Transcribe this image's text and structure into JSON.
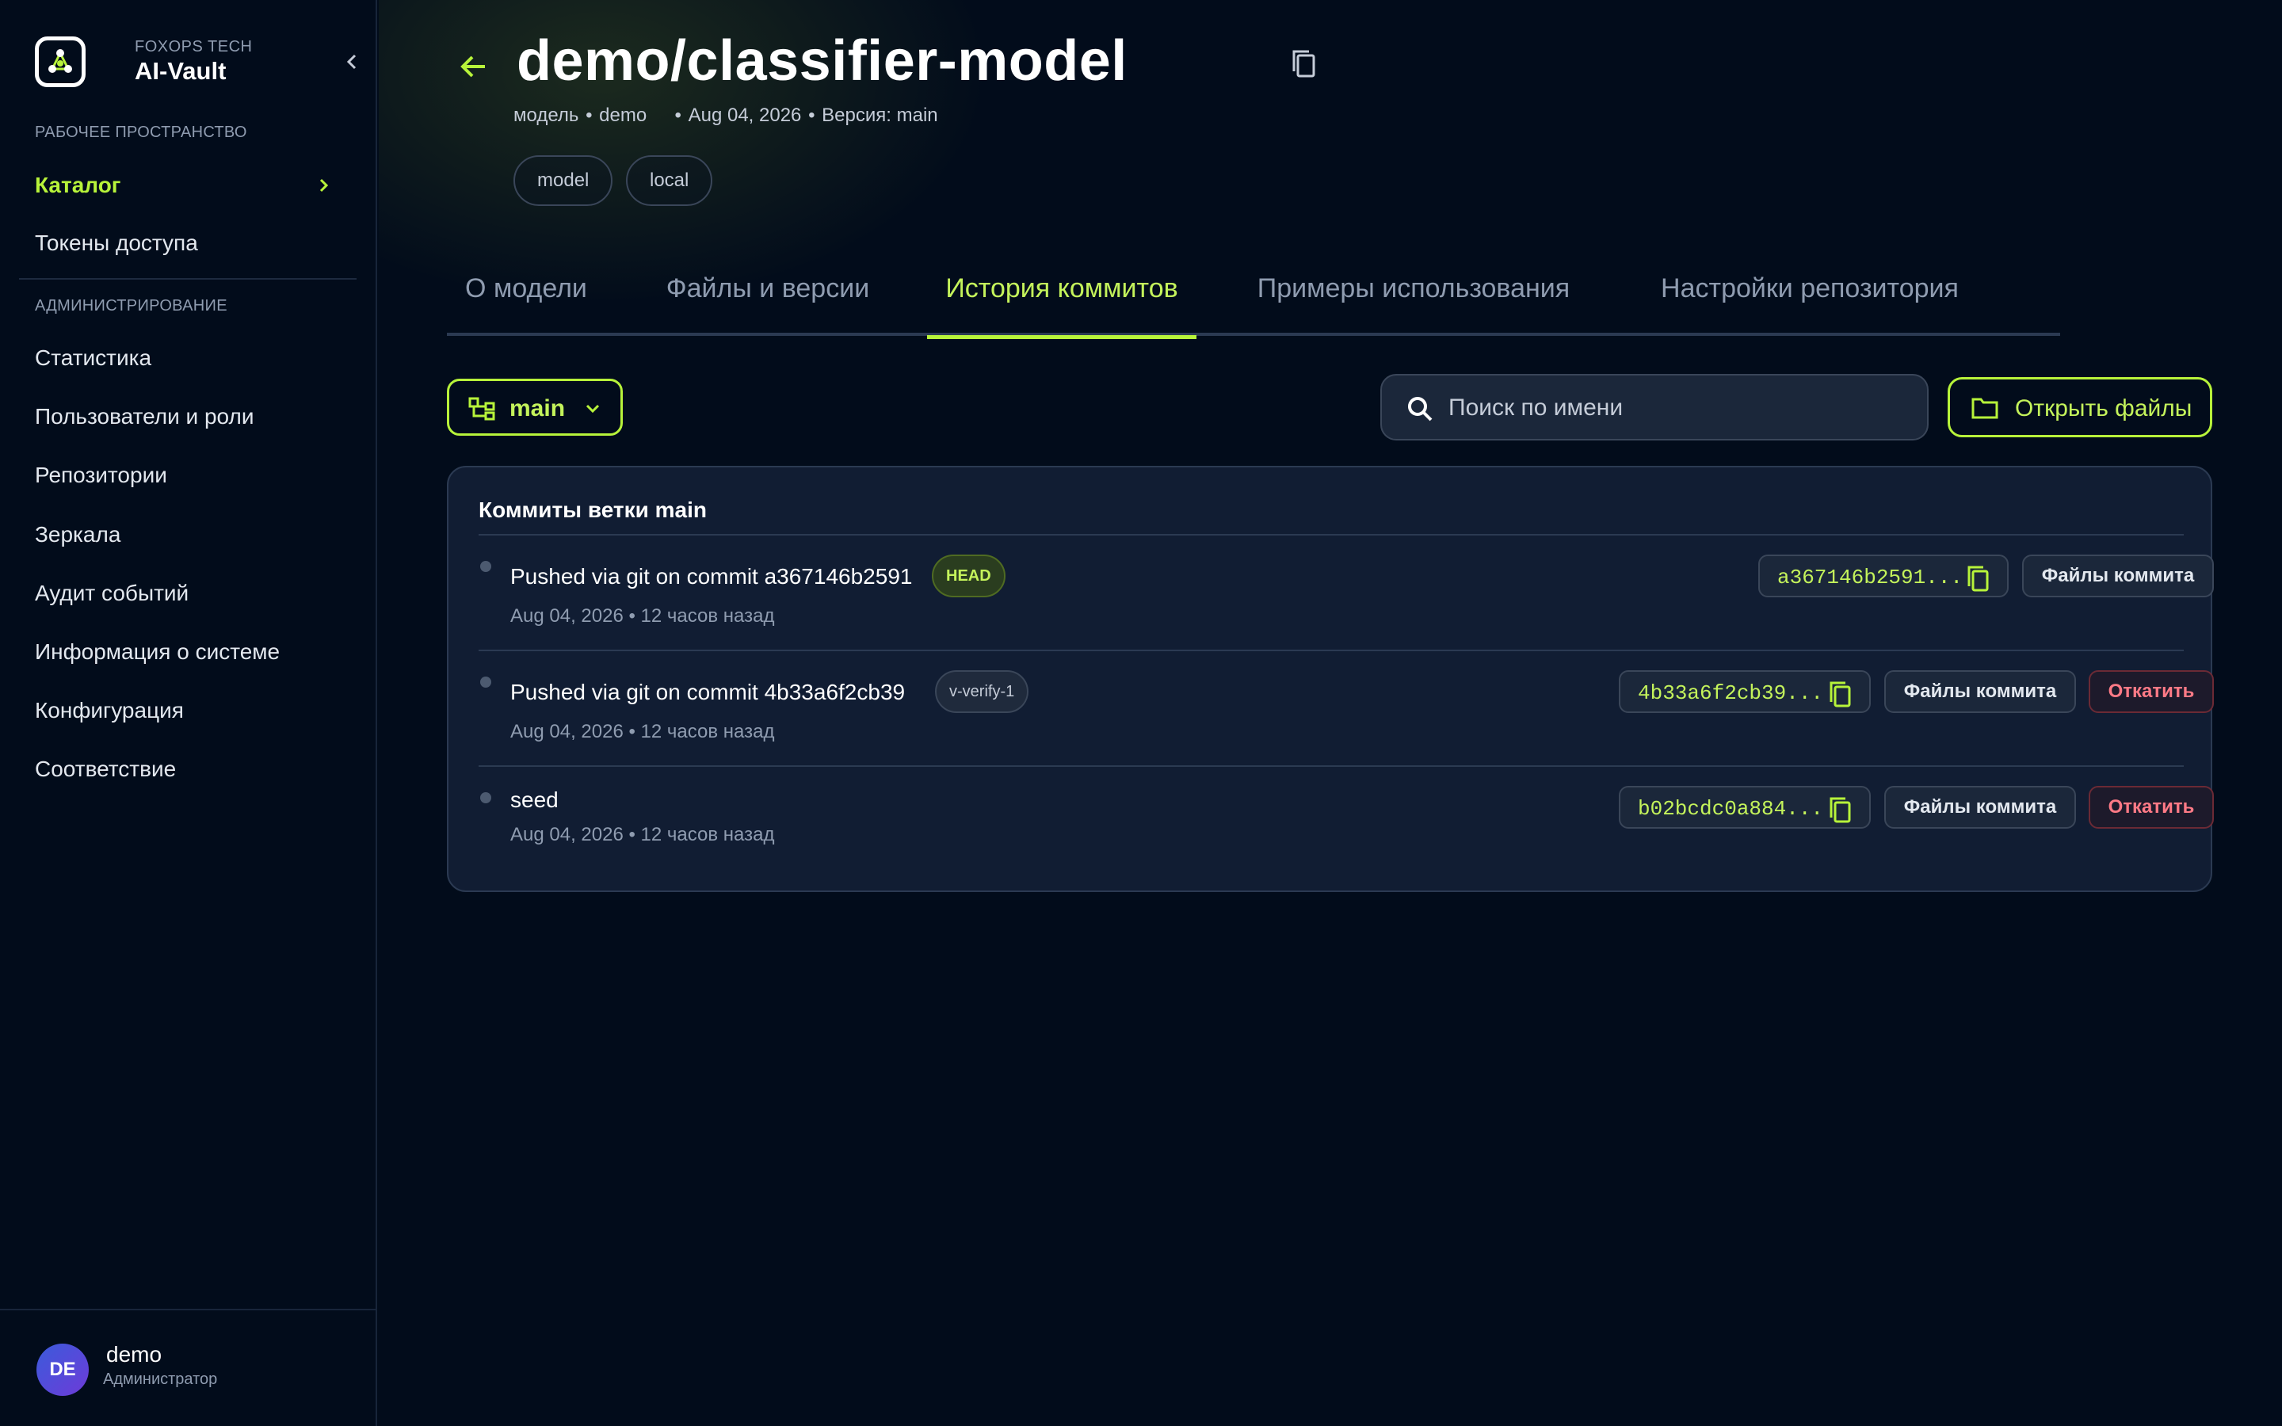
{
  "sidebar": {
    "brand": {
      "company": "FOXOPS TECH",
      "name": "AI-Vault"
    },
    "workspace_label": "РАБОЧЕЕ ПРОСТРАНСТВО",
    "workspace_items": [
      {
        "label": "Каталог",
        "active": true
      },
      {
        "label": "Токены доступа"
      }
    ],
    "admin_label": "АДМИНИСТРИРОВАНИЕ",
    "admin_items": [
      {
        "label": "Статистика"
      },
      {
        "label": "Пользователи и роли"
      },
      {
        "label": "Репозитории"
      },
      {
        "label": "Зеркала"
      },
      {
        "label": "Аудит событий"
      },
      {
        "label": "Информация о системе"
      },
      {
        "label": "Конфигурация"
      },
      {
        "label": "Соответствие"
      }
    ],
    "user": {
      "initials": "DE",
      "name": "demo",
      "role": "Администратор"
    }
  },
  "header": {
    "title": "demo/classifier-model",
    "meta": {
      "kind": "модель",
      "owner": "demo",
      "date": "Aug 04, 2026",
      "version_label": "Версия: main"
    },
    "tags": [
      "model",
      "local"
    ]
  },
  "tabs": [
    {
      "label": "О модели"
    },
    {
      "label": "Файлы и версии"
    },
    {
      "label": "История коммитов",
      "active": true
    },
    {
      "label": "Примеры использования"
    },
    {
      "label": "Настройки репозитория"
    }
  ],
  "toolbar": {
    "branch": "main",
    "search_placeholder": "Поиск по имени",
    "open_files_label": "Открыть файлы"
  },
  "commits": {
    "title": "Коммиты ветки main",
    "files_label": "Файлы коммита",
    "revert_label": "Откатить",
    "items": [
      {
        "message": "Pushed via git on commit a367146b2591",
        "badge": "HEAD",
        "badge_type": "head",
        "date": "Aug 04, 2026 • 12 часов назад",
        "hash": "a367146b2591...",
        "can_revert": false
      },
      {
        "message": "Pushed via git on commit 4b33a6f2cb39",
        "badge": "v-verify-1",
        "badge_type": "tag",
        "date": "Aug 04, 2026 • 12 часов назад",
        "hash": "4b33a6f2cb39...",
        "can_revert": true
      },
      {
        "message": "seed",
        "badge": "",
        "badge_type": "",
        "date": "Aug 04, 2026 • 12 часов назад",
        "hash": "b02bcdc0a884...",
        "can_revert": true
      }
    ]
  },
  "colors": {
    "accent": "#b7f33a",
    "background": "#020c1b",
    "card": "#111d33",
    "danger": "#ff7a86"
  }
}
